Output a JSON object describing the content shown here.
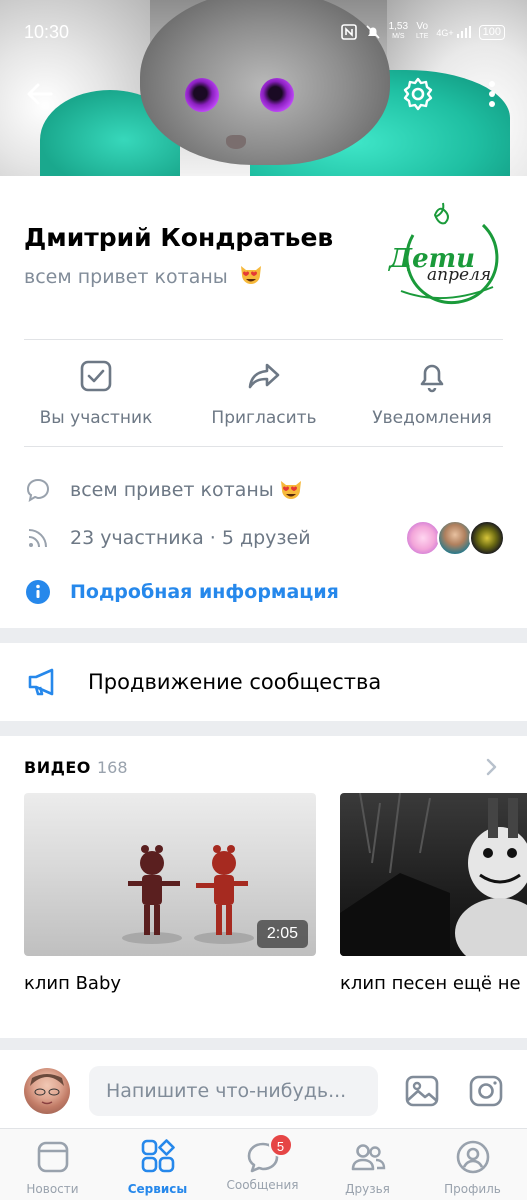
{
  "status_bar": {
    "time": "10:30",
    "speed_value": "1,53",
    "speed_unit": "M/S",
    "network_top": "Vo",
    "network_bottom": "LTE",
    "network_type": "4G+",
    "battery": "100"
  },
  "community": {
    "name": "Дмитрий Кондратьев",
    "status": "всем привет котаны",
    "logo_line1": "Дети",
    "logo_line2": "апреля"
  },
  "actions": [
    {
      "label": "Вы участник",
      "icon": "check-square-icon"
    },
    {
      "label": "Пригласить",
      "icon": "share-arrow-icon"
    },
    {
      "label": "Уведомления",
      "icon": "bell-icon"
    }
  ],
  "info": {
    "status_text": "всем привет котаны",
    "members_text": "23 участника · 5 друзей",
    "details_link": "Подробная информация"
  },
  "promotion": {
    "label": "Продвижение сообщества"
  },
  "videos": {
    "title": "ВИДЕО",
    "count": "168",
    "items": [
      {
        "label": "клип Baby",
        "duration": "2:05"
      },
      {
        "label": "клип песен ещё не к"
      }
    ]
  },
  "composer": {
    "placeholder": "Напишите что-нибудь..."
  },
  "tabs": [
    {
      "label": "Новости",
      "icon": "news-icon"
    },
    {
      "label": "Сервисы",
      "icon": "services-icon",
      "active": true
    },
    {
      "label": "Сообщения",
      "icon": "messages-icon",
      "badge": "5"
    },
    {
      "label": "Друзья",
      "icon": "friends-icon"
    },
    {
      "label": "Профиль",
      "icon": "profile-icon"
    }
  ],
  "colors": {
    "accent": "#2688eb",
    "secondary_text": "#6d7885",
    "badge": "#e64646",
    "cover_teal": "#1fbfa2",
    "logo_green": "#1a9a3a"
  }
}
